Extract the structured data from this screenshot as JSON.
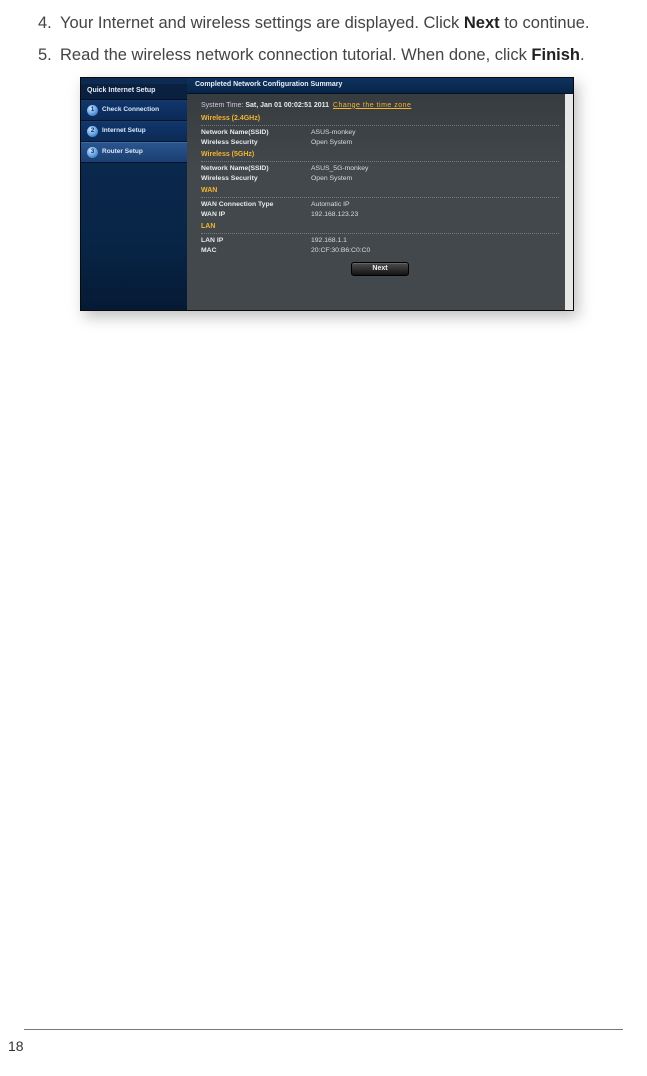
{
  "steps": {
    "s4": {
      "num": "4.",
      "pre": "Your Internet and wireless settings are displayed. Click ",
      "bold": "Next",
      "post": " to continue."
    },
    "s5": {
      "num": "5.",
      "pre": "Read the wireless network connection tutorial. When done, click ",
      "bold": "Finish",
      "post": "."
    }
  },
  "router_ui": {
    "sidebar": {
      "title": "Quick Internet Setup",
      "items": [
        {
          "num": "1",
          "label": "Check Connection"
        },
        {
          "num": "2",
          "label": "Internet Setup"
        },
        {
          "num": "3",
          "label": "Router Setup"
        }
      ]
    },
    "summary_title": "Completed Network Configuration Summary",
    "system_time": {
      "label": "System Time:",
      "value": "Sat, Jan 01 00:02:51 2011",
      "link": "Change the time zone"
    },
    "sections": {
      "w24": {
        "title": "Wireless (2.4GHz)",
        "rows": [
          {
            "k": "Network Name(SSID)",
            "v": "ASUS-monkey"
          },
          {
            "k": "Wireless Security",
            "v": "Open System"
          }
        ]
      },
      "w5": {
        "title": "Wireless (5GHz)",
        "rows": [
          {
            "k": "Network Name(SSID)",
            "v": "ASUS_5G-monkey"
          },
          {
            "k": "Wireless Security",
            "v": "Open System"
          }
        ]
      },
      "wan": {
        "title": "WAN",
        "rows": [
          {
            "k": "WAN Connection Type",
            "v": "Automatic IP"
          },
          {
            "k": "WAN IP",
            "v": "192.168.123.23"
          }
        ]
      },
      "lan": {
        "title": "LAN",
        "rows": [
          {
            "k": "LAN IP",
            "v": "192.168.1.1"
          },
          {
            "k": "MAC",
            "v": "20:CF:30:B6:C0:C0"
          }
        ]
      }
    },
    "next_label": "Next"
  },
  "page_number": "18"
}
